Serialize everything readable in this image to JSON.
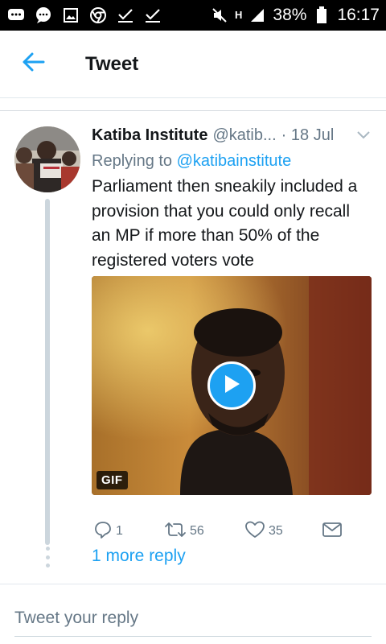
{
  "status_bar": {
    "battery": "38%",
    "time": "16:17",
    "network": "H",
    "icons": [
      "chat-bubble-icon",
      "message-icon",
      "gallery-icon",
      "chrome-icon",
      "check-icon",
      "check-icon",
      "mute-icon",
      "h-network-icon",
      "signal-icon",
      "battery-icon"
    ]
  },
  "header": {
    "title": "Tweet",
    "back_icon": "back-arrow-icon"
  },
  "tweet": {
    "author_name": "Katiba Institute",
    "author_handle": "@katib...",
    "date": "· 18 Jul",
    "replying_prefix": "Replying to",
    "replying_to": "@katibainstitute",
    "text": "Parliament then sneakily included a provision that you could only recall an MP if more than 50% of the registered voters vote",
    "media": {
      "badge": "GIF",
      "play_icon": "play-icon"
    },
    "actions": {
      "reply_count": "1",
      "retweet_count": "56",
      "like_count": "35"
    },
    "more_replies": "1 more reply"
  },
  "composer": {
    "placeholder": "Tweet your reply"
  },
  "colors": {
    "accent": "#1da1f2",
    "text": "#14171a",
    "secondary": "#657786",
    "divider": "#e1e8ed"
  }
}
